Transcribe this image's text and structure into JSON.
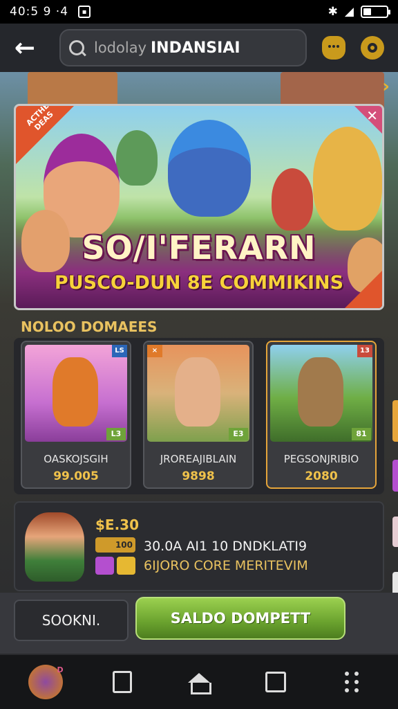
{
  "status_bar": {
    "time": "40:5 9 ·4"
  },
  "top_bar": {
    "search_placeholder": "lodolay",
    "search_value": "INDANSIAI"
  },
  "hero": {
    "title": "SO/I'FERARN",
    "subtitle": "PUSCO-DUN 8E COMMIKINS",
    "corner_badge": "ACTHE DEAS"
  },
  "section": {
    "title": "NOLOO DOMAEES"
  },
  "cards": [
    {
      "name": "OASKOJSGIH",
      "price": "99.005",
      "tag": "LS",
      "badge": "L3"
    },
    {
      "name": "JROREAJIBLAIN",
      "price": "9898",
      "tag": "×",
      "badge": "E3"
    },
    {
      "name": "PEGSONJRIBIO",
      "price": "2080",
      "tag": "13",
      "badge": "81"
    }
  ],
  "promo": {
    "amount": "$E.30",
    "chip": "100",
    "line1": "30.0A AI1 10 DNDKLATI9",
    "line2": "6IJORO CORE MERITEVIM"
  },
  "actions": {
    "secondary": "SOOKNI.",
    "primary": "SALDO DOMPETT"
  },
  "nav": {
    "badge": "D"
  },
  "colors": {
    "accent_gold": "#f0c24b",
    "primary_green": "#6aa22e",
    "banner_magenta": "#8b2f7e",
    "card_highlight": "#e6a53a"
  },
  "icons": [
    "back-arrow-icon",
    "search-icon",
    "owl-icon",
    "gear-icon",
    "close-icon",
    "chevron-right-icon",
    "home-icon",
    "recents-icon",
    "square-icon",
    "menu-dots-icon"
  ]
}
